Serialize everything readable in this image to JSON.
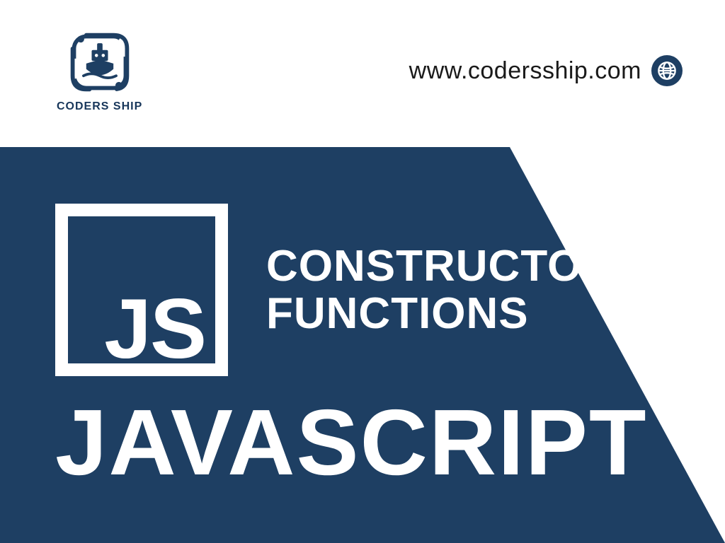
{
  "colors": {
    "navy": "#1e3f63",
    "navy_dark": "#17365a",
    "white": "#ffffff",
    "text": "#1a1a1a"
  },
  "brand": {
    "name": "CODERS SHIP"
  },
  "url": {
    "text": "www.codersship.com"
  },
  "badge": {
    "text": "JS"
  },
  "topic": {
    "line1": "CONSTRUCTOR",
    "line2": "FUNCTIONS"
  },
  "language": {
    "title": "JAVASCRIPT"
  }
}
